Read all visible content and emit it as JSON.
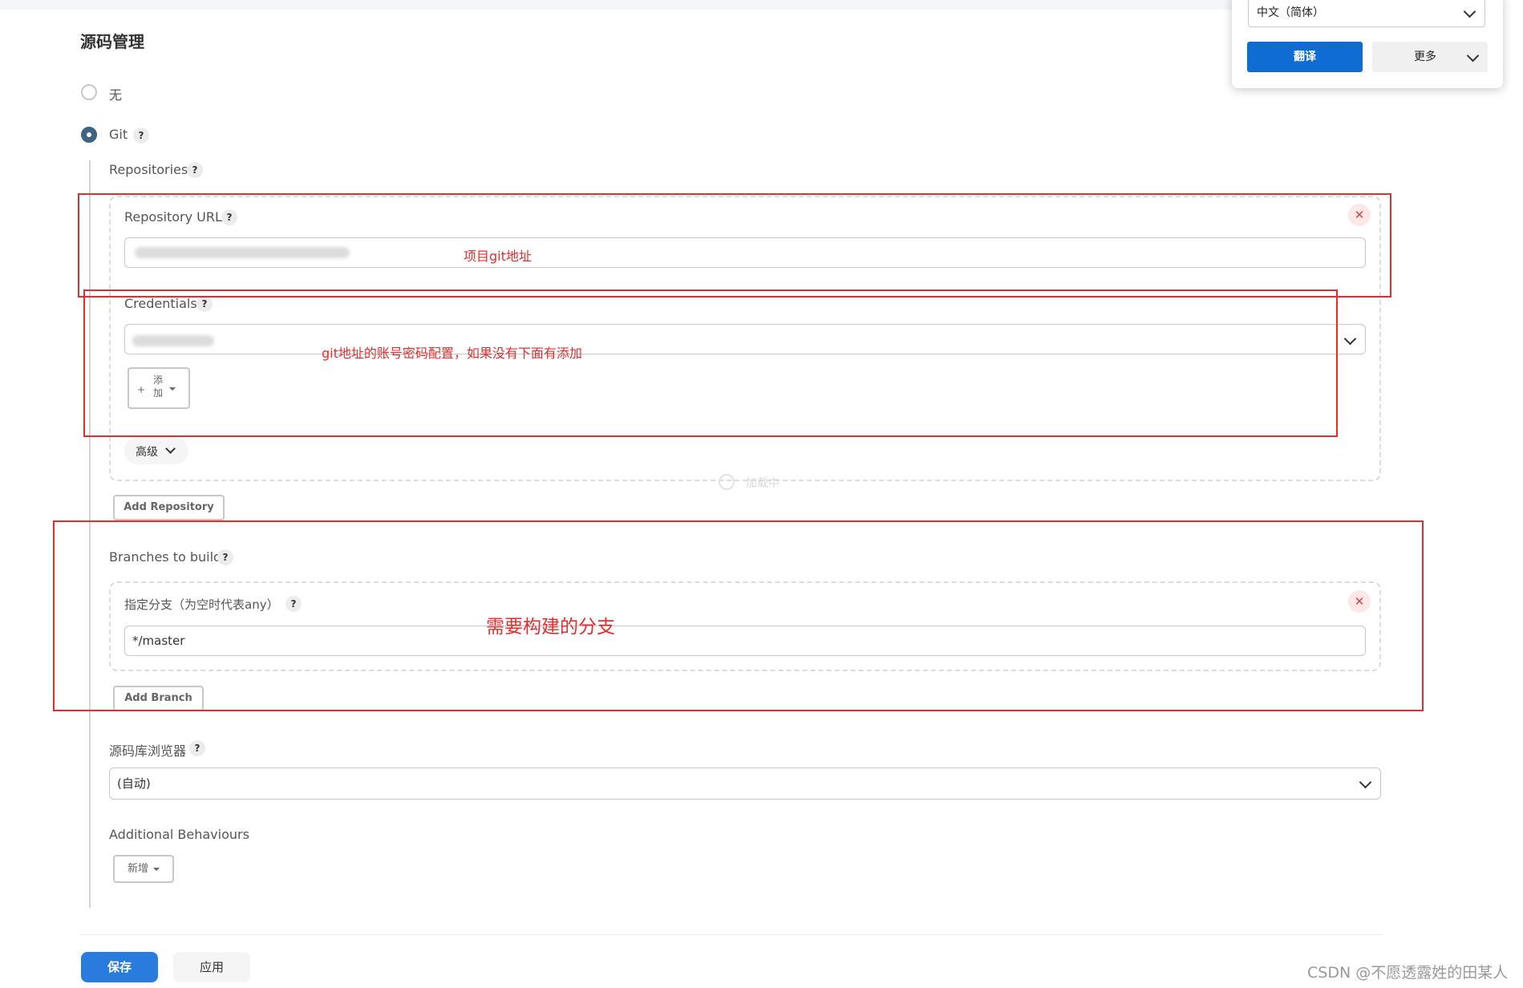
{
  "section": {
    "title": "源码管理"
  },
  "scm_options": [
    {
      "label": "无",
      "selected": false
    },
    {
      "label": "Git",
      "selected": true
    }
  ],
  "git": {
    "repositories_label": "Repositories",
    "repository_url": {
      "label": "Repository URL",
      "value": ""
    },
    "credentials": {
      "label": "Credentials",
      "value": ""
    },
    "add_credentials_label": "添加",
    "advanced_label": "高级",
    "loading_text": "加载中",
    "add_repository_label": "Add Repository",
    "branches_to_build_label": "Branches to build",
    "branch_specifier": {
      "label": "指定分支（为空时代表any）",
      "value": "*/master"
    },
    "add_branch_label": "Add Branch",
    "repo_browser": {
      "label": "源码库浏览器",
      "value": "(自动)"
    },
    "additional_behaviours_label": "Additional Behaviours",
    "add_behaviour_label": "新增"
  },
  "actions": {
    "save_label": "保存",
    "apply_label": "应用"
  },
  "annotations": {
    "repo_url_note": "项目git地址",
    "credentials_note": "git地址的账号密码配置，如果没有下面有添加",
    "branch_note": "需要构建的分支",
    "color": "#e52d2d"
  },
  "translate_popup": {
    "language": "中文（简体）",
    "translate_label": "翻译",
    "more_label": "更多"
  },
  "watermark": "CSDN @不愿透露姓的田某人",
  "colors": {
    "primary_button": "#2a7bde",
    "radio_checked": "#3f6384",
    "translate_button": "#0f6cd2"
  }
}
